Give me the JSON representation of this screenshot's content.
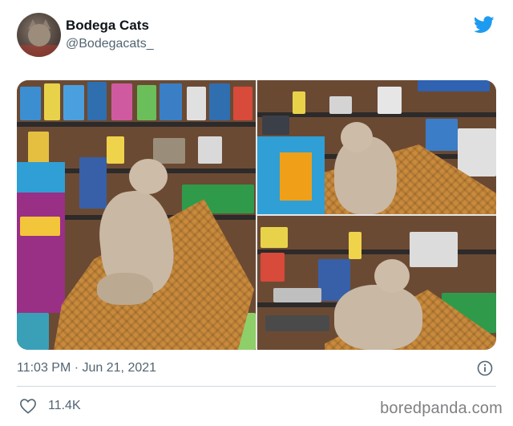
{
  "tweet": {
    "display_name": "Bodega Cats",
    "handle": "@Bodegacats_",
    "timestamp": "11:03 PM · Jun 21, 2021",
    "likes": "11.4K"
  },
  "icons": {
    "brand": "twitter-bird-icon",
    "info": "info-icon",
    "like": "heart-icon"
  },
  "colors": {
    "twitter_blue": "#1d9bf0",
    "secondary_text": "#536471",
    "divider": "#cfd9de"
  },
  "watermark": "boredpanda.com"
}
